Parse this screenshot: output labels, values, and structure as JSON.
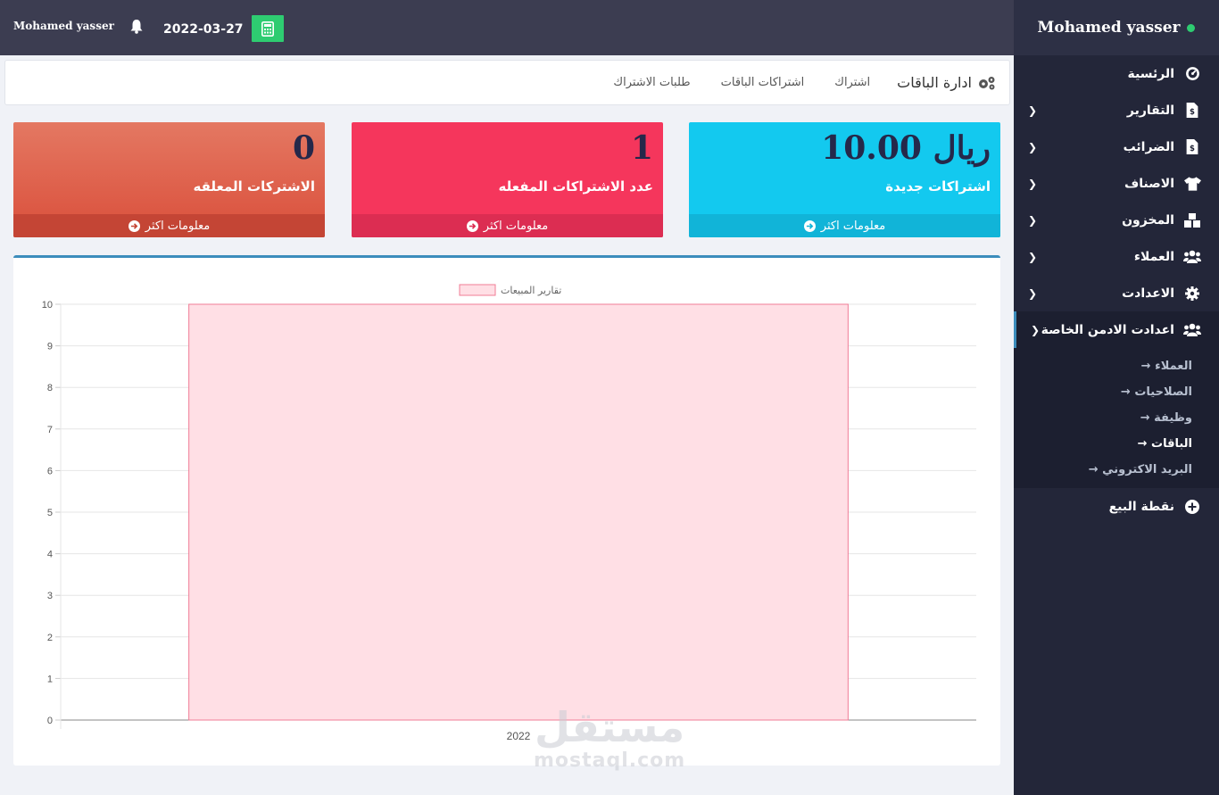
{
  "sidebar": {
    "user_name": "Mohamed yasser",
    "items": [
      {
        "label": "الرئسية",
        "icon": "dashboard-icon",
        "chevron": false
      },
      {
        "label": "التقارير",
        "icon": "file-invoice-icon",
        "chevron": true
      },
      {
        "label": "الضرائب",
        "icon": "file-invoice-icon",
        "chevron": true
      },
      {
        "label": "الاصناف",
        "icon": "tshirt-icon",
        "chevron": true
      },
      {
        "label": "المخزون",
        "icon": "boxes-icon",
        "chevron": true
      },
      {
        "label": "العملاء",
        "icon": "users-icon",
        "chevron": true
      },
      {
        "label": "الاعدادت",
        "icon": "gear-icon",
        "chevron": true
      },
      {
        "label": "اعدادت الادمن الخاصة",
        "icon": "users-icon",
        "chevron": true
      }
    ],
    "sub_items": [
      {
        "label": "العملاء",
        "arrow": "→"
      },
      {
        "label": "الصلاحيات",
        "arrow": "→"
      },
      {
        "label": "وظيفة",
        "arrow": "→"
      },
      {
        "label": "الباقات",
        "arrow": "→"
      },
      {
        "label": "البريد الاكتروني",
        "arrow": "→"
      }
    ],
    "pos_label": "نقطة البيع"
  },
  "topbar": {
    "user_name": "Mohamed yasser",
    "date": "2022-03-27"
  },
  "nav": {
    "title": "ادارة الباقات",
    "links": [
      "اشتراك",
      "اشتراكات الباقات",
      "طلبات الاشتراك"
    ]
  },
  "cards": [
    {
      "value": "ريال 10.00",
      "label": "اشتراكات جديدة",
      "footer": "معلومات اكثر",
      "color": "#13c9ef"
    },
    {
      "value": "1",
      "label": "عدد الاشتراكات المفعله",
      "footer": "معلومات اكثر",
      "color": "#f5365c"
    },
    {
      "value": "0",
      "label": "الاشتركات المعلقه",
      "footer": "معلومات اكثر",
      "color": "#da4f3b"
    }
  ],
  "chart_data": {
    "type": "bar",
    "categories": [
      "2022"
    ],
    "series": [
      {
        "name": "تقارير المبيعات",
        "values": [
          10
        ]
      }
    ],
    "ylim": [
      0,
      10
    ],
    "yticks": [
      0,
      1,
      2,
      3,
      4,
      5,
      6,
      7,
      8,
      9,
      10
    ],
    "grid": true,
    "legend": "top-center",
    "bar_fill": "#ffdfe5",
    "bar_stroke": "#f07c96"
  },
  "watermark": {
    "arabic": "مستقل",
    "latin": "mostaql.com"
  }
}
